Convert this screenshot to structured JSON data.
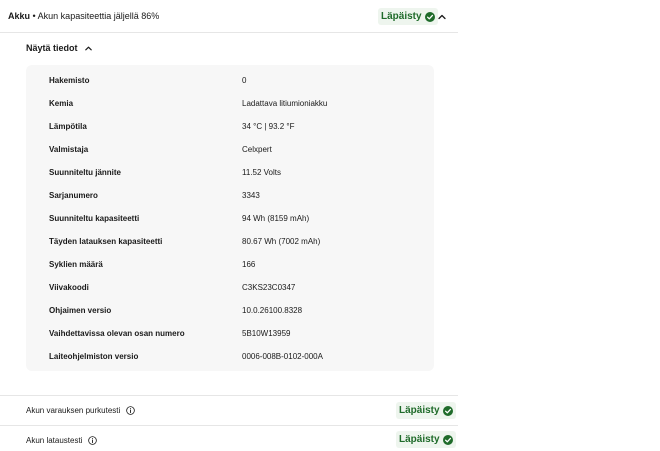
{
  "header": {
    "title_bold": "Akku",
    "title_rest": " • Akun kapasiteettia jäljellä 86%",
    "status": "Läpäisty"
  },
  "details": {
    "toggle_label": "Näytä tiedot",
    "rows": [
      {
        "key": "Hakemisto",
        "value": "0"
      },
      {
        "key": "Kemia",
        "value": "Ladattava litiumioniakku"
      },
      {
        "key": "Lämpötila",
        "value": "34 °C | 93.2 °F"
      },
      {
        "key": "Valmistaja",
        "value": "Celxpert"
      },
      {
        "key": "Suunniteltu jännite",
        "value": "11.52 Volts"
      },
      {
        "key": "Sarjanumero",
        "value": "3343"
      },
      {
        "key": "Suunniteltu kapasiteetti",
        "value": "94 Wh (8159 mAh)"
      },
      {
        "key": "Täyden latauksen kapasiteetti",
        "value": "80.67 Wh (7002 mAh)"
      },
      {
        "key": "Syklien määrä",
        "value": "166"
      },
      {
        "key": "Viivakoodi",
        "value": "C3KS23C0347"
      },
      {
        "key": "Ohjaimen versio",
        "value": "10.0.26100.8328"
      },
      {
        "key": "Vaihdettavissa olevan osan numero",
        "value": "5B10W13959"
      },
      {
        "key": "Laiteohjelmiston versio",
        "value": "0006-008B-0102-000A"
      }
    ]
  },
  "tests": [
    {
      "label": "Akun varauksen purkutesti",
      "status": "Läpäisty"
    },
    {
      "label": "Akun lataustesti",
      "status": "Läpäisty"
    }
  ],
  "colors": {
    "pass_green": "#1f6b2a",
    "pill_bg": "#eef5ee",
    "panel_bg": "#f7f7f7"
  },
  "icons": {
    "status": "check-circle-icon",
    "collapse": "chevron-up-icon",
    "info": "info-icon"
  }
}
